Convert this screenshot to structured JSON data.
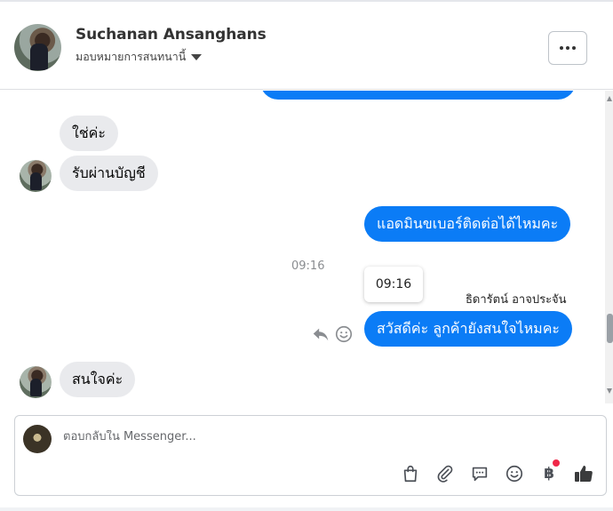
{
  "header": {
    "contact_name": "Suchanan Ansanghans",
    "assign_label": "มอบหมายการสนทนานี้"
  },
  "conversation": {
    "messages": [
      {
        "direction": "in",
        "text": "ใช่ค่ะ"
      },
      {
        "direction": "in",
        "text": "รับผ่านบัญชี"
      },
      {
        "direction": "out",
        "text": "แอดมินขเบอร์ติดต่อได้ไหมคะ"
      },
      {
        "direction": "out",
        "text": "สวัสดีค่ะ ลูกค้ายังสนใจไหมคะ"
      },
      {
        "direction": "in",
        "text": "สนใจค่ะ"
      }
    ],
    "timestamp": "09:16",
    "tooltip_time": "09:16",
    "sender_name": "ธิดารัตน์ อาจประจัน"
  },
  "composer": {
    "placeholder": "ตอบกลับใน Messenger...",
    "currency_symbol": "฿"
  },
  "colors": {
    "outgoing_bubble": "#0b7cf6",
    "incoming_bubble": "#e9eaed",
    "notification_dot": "#f02849"
  },
  "icons": [
    "more-icon",
    "caret-down-icon",
    "reply-icon",
    "smiley-icon",
    "shopping-bag-icon",
    "paperclip-icon",
    "saved-replies-icon",
    "emoji-icon",
    "baht-icon",
    "thumbs-up-icon"
  ]
}
